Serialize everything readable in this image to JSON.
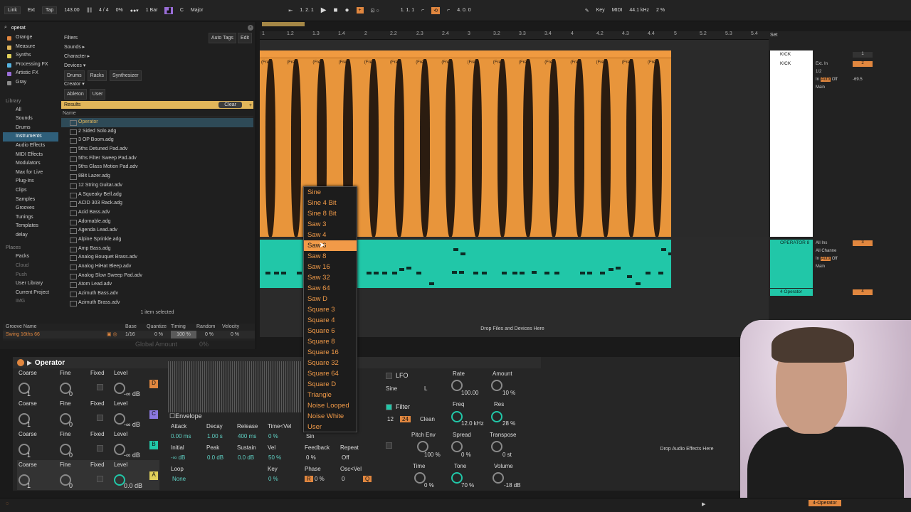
{
  "transport": {
    "link": "Link",
    "ext": "Ext",
    "tap": "Tap",
    "tempo": "143.00",
    "signature": "4 / 4",
    "pct": "0%",
    "quant": "1 Bar",
    "key": "C",
    "scale": "Major",
    "position": "1.  2.  1",
    "loop_start": "1.  1.  1",
    "loop_len": "4.  0.  0",
    "key_label": "Key",
    "midi_label": "MIDI",
    "sample_rate": "44.1 kHz",
    "cpu": "2 %"
  },
  "browser": {
    "search": "operat",
    "filters_label": "Filters",
    "auto_tags": "Auto Tags",
    "edit": "Edit",
    "collections": [
      {
        "label": "Orange",
        "color": "#e1873f"
      },
      {
        "label": "Measure",
        "color": "#e1b65a"
      },
      {
        "label": "Synths",
        "color": "#e0d05a"
      },
      {
        "label": "Processing FX",
        "color": "#55b3e0"
      },
      {
        "label": "Artistic FX",
        "color": "#9a6ed8"
      },
      {
        "label": "Gray",
        "color": "#8a8a8a"
      }
    ],
    "library_header": "Library",
    "library": [
      "All",
      "Sounds",
      "Drums",
      "Instruments",
      "Audio Effects",
      "MIDI Effects",
      "Modulators",
      "Max for Live",
      "Plug-Ins",
      "Clips",
      "Samples",
      "Grooves",
      "Tunings",
      "Templates",
      "delay"
    ],
    "places_header": "Places",
    "places": [
      "Packs",
      "Cloud",
      "Push",
      "User Library",
      "Current Project",
      "IMG"
    ],
    "filter_rows": {
      "sounds": "Sounds ▸",
      "character": "Character ▸",
      "devices": "Devices ▾",
      "dev_tags": [
        "Drums",
        "Racks",
        "Synthesizer"
      ],
      "creator": "Creator ▾",
      "creator_tags": [
        "Ableton",
        "User"
      ]
    },
    "results_label": "Results",
    "clear_label": "Clear",
    "name_col": "Name",
    "files": [
      "Operator",
      "2 Sided Solo.adg",
      "3 OP Boom.adg",
      "5ths Detuned Pad.adv",
      "5ths Filter Sweep Pad.adv",
      "5ths Glass Motion Pad.adv",
      "8Bit Lazer.adg",
      "12 String Guitar.adv",
      "A Squeaky Bell.adg",
      "ACID 303 Rack.adg",
      "Acid Bass.adv",
      "Adornable.adg",
      "Agenda Lead.adv",
      "Alpine Sprinkle.adg",
      "Amp Bass.adg",
      "Analog Bouquet Brass.adv",
      "Analog HiHat Bleep.adv",
      "Analog Slow Sweep Pad.adv",
      "Atom Lead.adv",
      "Azimuth Bass.adv",
      "Azimuth Brass.adv"
    ],
    "status": "1 item selected"
  },
  "groove": {
    "headers": [
      "Groove Name",
      "Base",
      "Quantize",
      "Timing",
      "Random",
      "Velocity"
    ],
    "name": "Swing 16ths 66",
    "base": "1/16",
    "quantize": "0 %",
    "timing": "100 %",
    "random": "0 %",
    "velocity": "0 %",
    "global_amount_label": "Global Amount",
    "global_amount": "0%"
  },
  "arrangement": {
    "ruler": [
      "1",
      "1.2",
      "1.3",
      "1.4",
      "2",
      "2.2",
      "2.3",
      "2.4",
      "3",
      "3.2",
      "3.3",
      "3.4",
      "4",
      "4.2",
      "4.3",
      "4.4",
      "5",
      "5.2",
      "5.3",
      "5.4"
    ],
    "clip_label": "(Free",
    "drop_files": "Drop Files and Devices Here",
    "drop_audio": "Drop Audio Effects Here",
    "set_label": "Set"
  },
  "tracks": [
    {
      "name": "KICK",
      "num": "1"
    },
    {
      "name": "KICK",
      "num": "2"
    },
    {
      "name": "OPERATOR 8",
      "num": "3"
    },
    {
      "name": "4 Operator",
      "num": "4"
    }
  ],
  "mixer": {
    "input": "Ext. In",
    "sub": "1/2",
    "in": "In",
    "auto": "Auto",
    "off": "Off",
    "main": "Main",
    "vol": "-69.5",
    "all_ins": "All Ins",
    "all_channels": "All Channe"
  },
  "waveform_menu": {
    "items": [
      "Sine",
      "Sine 4 Bit",
      "Sine 8 Bit",
      "Saw 3",
      "Saw 4",
      "Saw 6",
      "Saw 8",
      "Saw 16",
      "Saw 32",
      "Saw 64",
      "Saw D",
      "Square 3",
      "Square 4",
      "Square 6",
      "Square 8",
      "Square 16",
      "Square 32",
      "Square 64",
      "Square D",
      "Triangle",
      "Noise Looped",
      "Noise White",
      "User"
    ],
    "selected": "Saw 6"
  },
  "operator": {
    "title": "Operator",
    "osc_labels": [
      "Coarse",
      "Fine",
      "Fixed",
      "Level"
    ],
    "oscs": [
      {
        "coarse": "1",
        "fine": "0",
        "level": "-∞ dB",
        "letter": "D",
        "color": "#e1873f"
      },
      {
        "coarse": "1",
        "fine": "0",
        "level": "-∞ dB",
        "letter": "C",
        "color": "#8a78e0"
      },
      {
        "coarse": "1",
        "fine": "0",
        "level": "-∞ dB",
        "letter": "B",
        "color": "#21c7a8"
      },
      {
        "coarse": "1",
        "fine": "0",
        "level": "0.0 dB",
        "letter": "A",
        "color": "#e0d05a"
      }
    ],
    "envelope_label": "Envelope",
    "env": {
      "attack_l": "Attack",
      "attack": "0.00 ms",
      "decay_l": "Decay",
      "decay": "1.00 s",
      "release_l": "Release",
      "release": "400 ms",
      "time_vel_l": "Time<Vel",
      "time_vel": "0 %",
      "initial_l": "Initial",
      "initial": "-∞ dB",
      "peak_l": "Peak",
      "peak": "0.0 dB",
      "sustain_l": "Sustain",
      "sustain": "0.0 dB",
      "vel_l": "Vel",
      "vel": "50 %",
      "loop_l": "Loop",
      "loop": "None",
      "key_l": "Key",
      "key": "0 %",
      "wave_l": "Sin",
      "feedback_l": "Feedback",
      "feedback": "0 %",
      "repeat_l": "Repeat",
      "repeat": "Off",
      "phase_l": "Phase",
      "phase": "0 %",
      "phase_r": "R",
      "osc_vel_l": "Osc<Vel",
      "osc_vel": "0",
      "osc_vel_q": "Q"
    },
    "lfo": {
      "label": "LFO",
      "wave": "Sine",
      "type": "L",
      "rate_l": "Rate",
      "rate": "100.00",
      "amount_l": "Amount",
      "amount": "10 %"
    },
    "filter": {
      "label": "Filter",
      "slope12": "12",
      "slope24": "24",
      "circuit": "Clean",
      "freq_l": "Freq",
      "freq": "12.0 kHz",
      "res_l": "Res",
      "res": "28 %"
    },
    "pitch": {
      "pitch_env_l": "Pitch Env",
      "pitch_env": "100 %",
      "spread_l": "Spread",
      "spread": "0 %",
      "transpose_l": "Transpose",
      "transpose": "0 st"
    },
    "global": {
      "time_l": "Time",
      "time": "0 %",
      "tone_l": "Tone",
      "tone": "70 %",
      "volume_l": "Volume",
      "volume": "-18 dB"
    }
  },
  "status_bar": {
    "device_tag": "4-Operator"
  }
}
